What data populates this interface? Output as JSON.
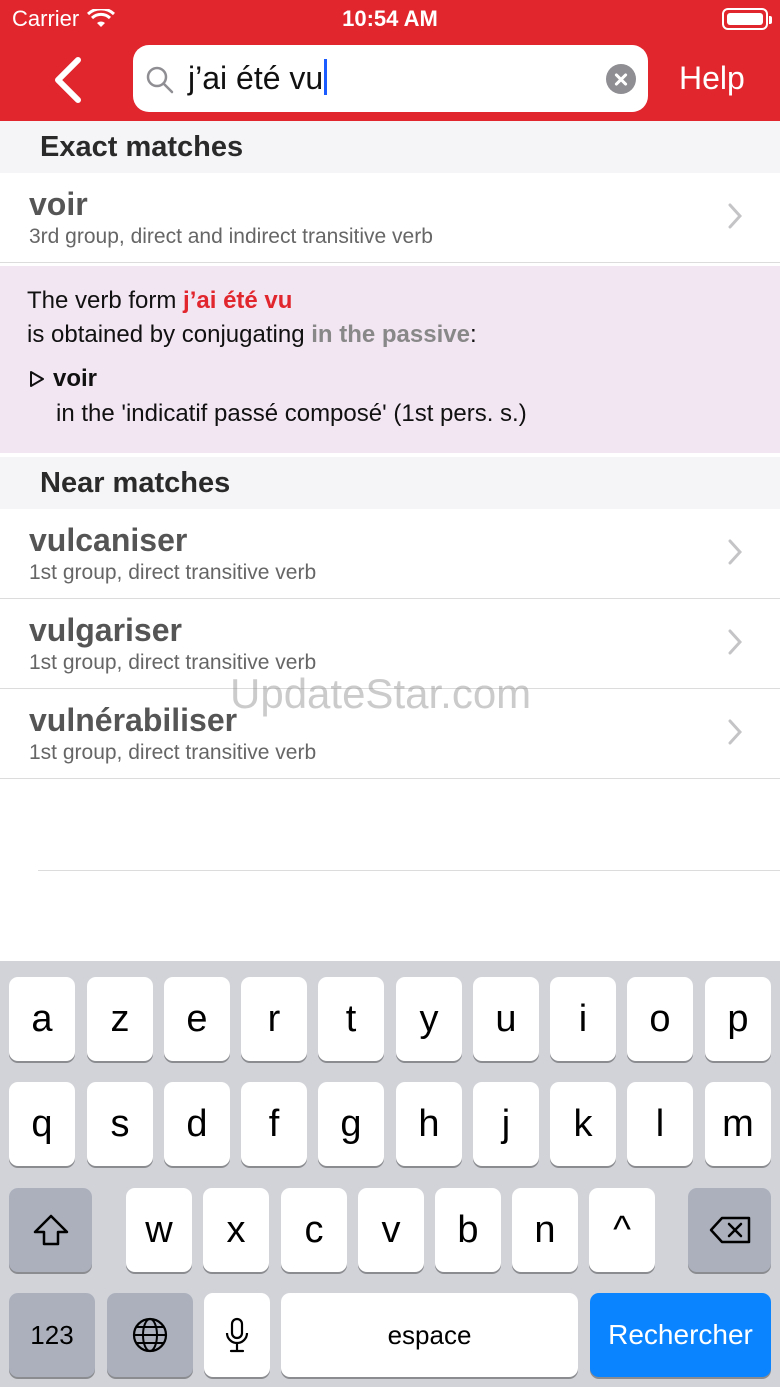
{
  "status_bar": {
    "carrier": "Carrier",
    "time": "10:54 AM"
  },
  "nav": {
    "search_value": "j’ai été vu",
    "help_label": "Help"
  },
  "sections": {
    "exact": "Exact matches",
    "near": "Near matches"
  },
  "exact_match": {
    "title": "voir",
    "subtitle": "3rd group, direct and indirect transitive verb"
  },
  "info": {
    "prefix": "The verb form ",
    "form": "j’ai été vu",
    "line2_prefix": "is obtained by conjugating ",
    "voice": "in the passive",
    "line2_suffix": ":",
    "verb": "voir",
    "detail": "in the 'indicatif passé composé' (1st pers. s.)"
  },
  "near_matches": [
    {
      "title": "vulcaniser",
      "subtitle": "1st group, direct transitive verb"
    },
    {
      "title": "vulgariser",
      "subtitle": "1st group, direct transitive verb"
    },
    {
      "title": "vulnérabiliser",
      "subtitle": "1st group, direct transitive verb"
    }
  ],
  "watermark": "UpdateStar.com",
  "keyboard": {
    "row1": [
      "a",
      "z",
      "e",
      "r",
      "t",
      "y",
      "u",
      "i",
      "o",
      "p"
    ],
    "row2": [
      "q",
      "s",
      "d",
      "f",
      "g",
      "h",
      "j",
      "k",
      "l",
      "m"
    ],
    "row3": [
      "w",
      "x",
      "c",
      "v",
      "b",
      "n",
      "^"
    ],
    "numbers_label": "123",
    "space_label": "espace",
    "search_label": "Rechercher"
  },
  "colors": {
    "brand_red": "#e1262e",
    "info_bg": "#f3e6f3",
    "key_blue": "#0a84ff"
  }
}
